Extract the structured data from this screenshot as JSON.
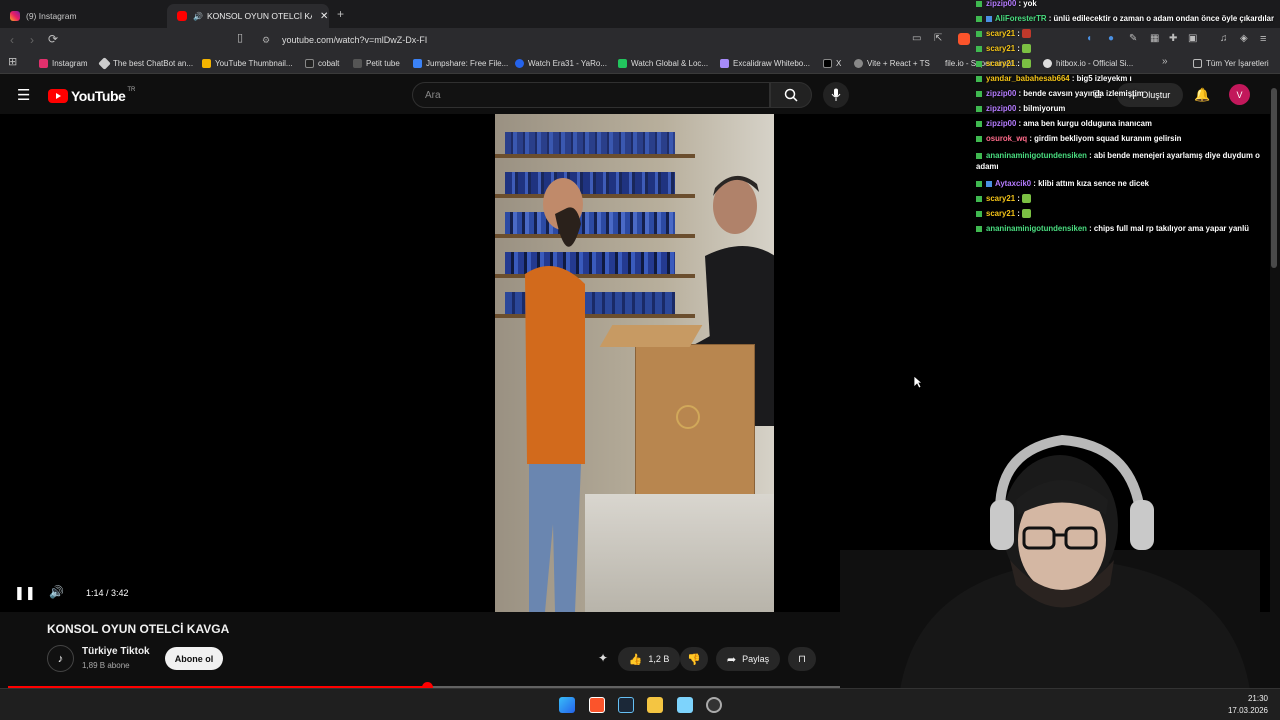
{
  "browser": {
    "tabs": [
      {
        "label": "(9) Instagram"
      },
      {
        "label": "KONSOL OYUN OTELCİ KAVGA"
      }
    ],
    "url": "youtube.com/watch?v=mlDwZ-Dx-FI",
    "bookmarks": [
      "Instagram",
      "The best ChatBot an...",
      "YouTube Thumbnail...",
      "cobalt",
      "Petit tube",
      "Jumpshare: Free File...",
      "Watch Era31 - YaRo...",
      "Watch Global & Loc...",
      "Excalidraw Whitebo...",
      "X",
      "Vite + React + TS",
      "file.io - Super simpl...",
      "hitbox.io - Official Si..."
    ],
    "all_bookmarks": "Tüm Yer İşaretleri"
  },
  "youtube": {
    "logo": "YouTube",
    "region": "TR",
    "search_placeholder": "Ara",
    "create_label": "Oluştur",
    "avatar_letter": "V",
    "player": {
      "time": "1:14 / 3:42",
      "progress": 0.465
    },
    "video_title": "KONSOL OYUN OTELCİ KAVGA",
    "channel": {
      "name": "Türkiye Tiktok",
      "subs": "1,89 B abone",
      "subscribe_label": "Abone ol"
    },
    "likes": "1,2 B",
    "share_label": "Paylaş"
  },
  "chat": [
    {
      "user": "zipzip00",
      "color": "#b57bff",
      "text": "yok"
    },
    {
      "user": "AliForesterTR",
      "color": "#4ade80",
      "text": "ünlü edilecektir o zaman o adam ondan önce öyle çıkardılar"
    },
    {
      "user": "scary21",
      "color": "#f5c518",
      "text": "",
      "emote": "#c0392b"
    },
    {
      "user": "scary21",
      "color": "#f5c518",
      "text": "",
      "emote": "#7bc043"
    },
    {
      "user": "scary21",
      "color": "#f5c518",
      "text": "",
      "emote": "#7bc043"
    },
    {
      "user": "yandar_babahesab664",
      "color": "#f5c518",
      "text": "big5 izleyekm ı"
    },
    {
      "user": "zipzip00",
      "color": "#b57bff",
      "text": "bende cavsın yayında izlemiştim"
    },
    {
      "user": "zipzip00",
      "color": "#b57bff",
      "text": "bilmiyorum"
    },
    {
      "user": "zipzip00",
      "color": "#b57bff",
      "text": "ama ben kurgu olduguna inanıcam"
    },
    {
      "user": "osurok_wq",
      "color": "#ff6b8a",
      "text": "girdim bekliyom squad kuranım gelirsin"
    },
    {
      "user": "ananinaminigotundensiken",
      "color": "#4ade80",
      "text": "abi bende menejeri ayarlamış diye duydum o adamı",
      "wrap": true
    },
    {
      "user": "Aytaxcik0",
      "color": "#b57bff",
      "text": "klibi attım kıza sence ne dicek"
    },
    {
      "user": "scary21",
      "color": "#f5c518",
      "text": "",
      "emote": "#7bc043"
    },
    {
      "user": "scary21",
      "color": "#f5c518",
      "text": "",
      "emote": "#7bc043"
    },
    {
      "user": "ananinaminigotundensiken",
      "color": "#4ade80",
      "text": "chips full mal rp takılıyor ama yapar yanlü"
    }
  ],
  "taskbar": {
    "time": "21:30",
    "date": "17.03.2026"
  }
}
